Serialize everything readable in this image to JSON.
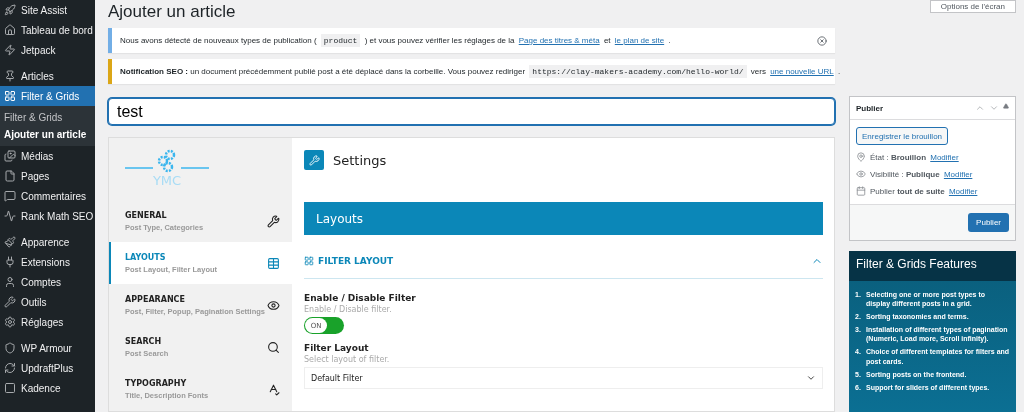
{
  "sidebar": {
    "groups": [
      {
        "items": [
          {
            "label": "Site Assist",
            "selected": false
          },
          {
            "label": "Tableau de bord",
            "selected": false
          },
          {
            "label": "Jetpack",
            "selected": false
          }
        ]
      },
      {
        "items": [
          {
            "label": "Articles",
            "selected": false
          },
          {
            "label": "Filter & Grids",
            "selected": true,
            "submenu": [
              {
                "label": "Filter & Grids",
                "selected": false
              },
              {
                "label": "Ajouter un article",
                "selected": true
              }
            ]
          },
          {
            "label": "Médias",
            "selected": false
          },
          {
            "label": "Pages",
            "selected": false
          },
          {
            "label": "Commentaires",
            "selected": false
          },
          {
            "label": "Rank Math SEO",
            "selected": false
          }
        ]
      },
      {
        "items": [
          {
            "label": "Apparence",
            "selected": false
          },
          {
            "label": "Extensions",
            "selected": false
          },
          {
            "label": "Comptes",
            "selected": false
          },
          {
            "label": "Outils",
            "selected": false
          },
          {
            "label": "Réglages",
            "selected": false
          }
        ]
      },
      {
        "items": [
          {
            "label": "WP Armour",
            "selected": false
          },
          {
            "label": "UpdraftPlus",
            "selected": false
          },
          {
            "label": "Kadence",
            "selected": false
          }
        ]
      }
    ]
  },
  "screen_options": "Options de l'écran",
  "page_title": "Ajouter un article",
  "notices": [
    {
      "color": "#72aee6",
      "parts": [
        {
          "kind": "text",
          "text": "Nous avons détecté de nouveaux types de publication ("
        },
        {
          "kind": "code",
          "text": "product"
        },
        {
          "kind": "text",
          "text": ") et vous pouvez vérifier les réglages de la"
        },
        {
          "kind": "link",
          "text": "Page des titres & méta"
        },
        {
          "kind": "text",
          "text": "et"
        },
        {
          "kind": "link",
          "text": "le plan de site"
        },
        {
          "kind": "text",
          "text": "."
        }
      ]
    },
    {
      "color": "#dba617",
      "parts": [
        {
          "kind": "text",
          "text": "**Notification SEO :** un document précédemment publié post a été déplacé dans la corbeille. Vous pouvez rediriger"
        },
        {
          "kind": "code",
          "text": "https://clay-makers-academy.com/hello-world/"
        },
        {
          "kind": "text",
          "text": "vers"
        },
        {
          "kind": "link",
          "text": "une nouvelle URL"
        },
        {
          "kind": "text",
          "text": "."
        }
      ]
    }
  ],
  "title_field": {
    "value": "test"
  },
  "plugin": {
    "logo": "YMC",
    "nav": [
      {
        "title": "GENERAL",
        "subtitle": "Post Type, Categories",
        "selected": false
      },
      {
        "title": "LAYOUTS",
        "subtitle": "Post Layout, Filter Layout",
        "selected": true
      },
      {
        "title": "APPEARANCE",
        "subtitle": "Post, Filter, Popup, Pagination Settings",
        "selected": false
      },
      {
        "title": "SEARCH",
        "subtitle": "Post Search",
        "selected": false
      },
      {
        "title": "TYPOGRAPHY",
        "subtitle": "Title, Description Fonts",
        "selected": false
      }
    ],
    "heading": "Settings",
    "banner": "Layouts",
    "section": {
      "title": "FILTER LAYOUT",
      "expanded": true,
      "fields": [
        {
          "kind": "toggle",
          "label": "Enable / Disable Filter",
          "hint": "Enable / Disable filter.",
          "toggle_label": "ON",
          "on": true
        },
        {
          "kind": "select",
          "label": "Filter Layout",
          "hint": "Select layout of filter.",
          "value": "Default Filter"
        }
      ]
    }
  },
  "publish_box": {
    "title": "Publier",
    "draft_button": "Enregistrer le brouillon",
    "rows": [
      {
        "text": "État : **Brouillon**",
        "link": "Modifier"
      },
      {
        "text": "Visibilité : **Publique**",
        "link": "Modifier"
      },
      {
        "text": "Publier **tout de suite**",
        "link": "Modifier"
      }
    ],
    "publish_button": "Publier"
  },
  "features": {
    "title": "Filter & Grids Features",
    "items": [
      {
        "number": "1.",
        "text": "Selecting one or more post types to display different posts in a grid."
      },
      {
        "number": "2.",
        "text": "Sorting taxonomies and terms."
      },
      {
        "number": "3.",
        "text": "Installation of different types of pagination (Numeric, Load more, Scroll infinity)."
      },
      {
        "number": "4.",
        "text": "Choice of different templates for filters and post cards."
      },
      {
        "number": "5.",
        "text": "Sorting posts on the frontend."
      },
      {
        "number": "6.",
        "text": "Support for sliders of different types."
      }
    ]
  }
}
